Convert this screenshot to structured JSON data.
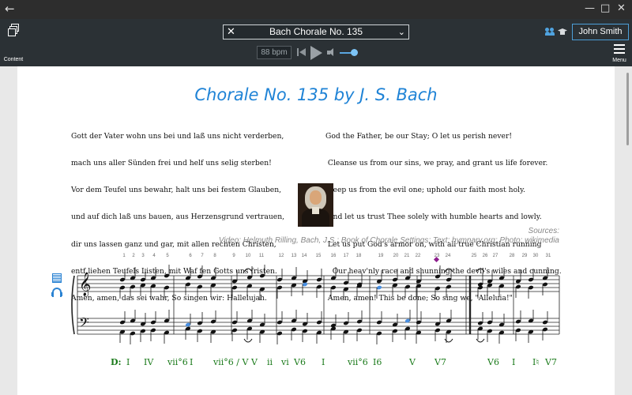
{
  "toolbar": {
    "content_label": "Content",
    "title": "Bach Chorale No. 135",
    "tempo": "88 bpm",
    "user_name": "John Smith",
    "menu_label": "Menu"
  },
  "page": {
    "heading": "Chorale No. 135 by J. S. Bach",
    "lyrics_german": [
      "Gott der Vater wohn uns bei und laß uns nicht verderben,",
      "mach uns aller Sünden frei und helf uns selig sterben!",
      "Vor dem Teufel uns bewahr, halt uns bei festem Glauben,",
      "und auf dich laß uns bauen, aus Herzensgrund vertrauen,",
      "dir uns lassen ganz und gar, mit allen rechten Christen,",
      "entf liehen Teufels Listen, mit Waf fen Gotts uns fristen.",
      "Amen, amen, das sei wahr, So singen wir: Hallelujah."
    ],
    "lyrics_english": [
      "God the Father, be our Stay; O let us perish never!",
      " Cleanse us from our sins, we pray, and grant us life forever.",
      " Keep us from the evil one; uphold our faith most holy.",
      " And let us trust Thee solely with humble hearts and lowly.",
      " Let us put God's armor on, with all true Christian running",
      "   Our heav'nly race and shunning the devil's wiles and cunning.",
      " Amen, amen! This be done; So sing we, \"Alleluia!\""
    ],
    "sources_line1": "Sources:",
    "sources_line2": "Video: Helmuth Rilling, Bach, J.S.: Book of Chorale Settings; Text: hymnary.org; Photo: wikimedia"
  },
  "score": {
    "measure_numbers": [
      "1",
      "2",
      "3",
      "4",
      "5",
      "6",
      "7",
      "8",
      "9",
      "10",
      "11",
      "12",
      "13",
      "14",
      "15",
      "16",
      "17",
      "18",
      "19",
      "20",
      "21",
      "22",
      "23",
      "24",
      "25",
      "26",
      "27",
      "28",
      "29",
      "30",
      "31"
    ],
    "key_label": "D:",
    "analysis": [
      "I",
      "IV",
      "vii°6",
      "I",
      "vii°6 / V",
      "V",
      "ii",
      "vi",
      "V6",
      "I",
      "vii°6",
      "I6",
      "V",
      "V7",
      "V6",
      "I",
      "I♮",
      "V7"
    ],
    "colors": {
      "analysis": "#1a7a1a",
      "accent": "#1f83d6",
      "highlight_blue": "#4a90e2",
      "highlight_orange": "#e07b2a",
      "highlight_purple": "#9b2fa8"
    }
  }
}
